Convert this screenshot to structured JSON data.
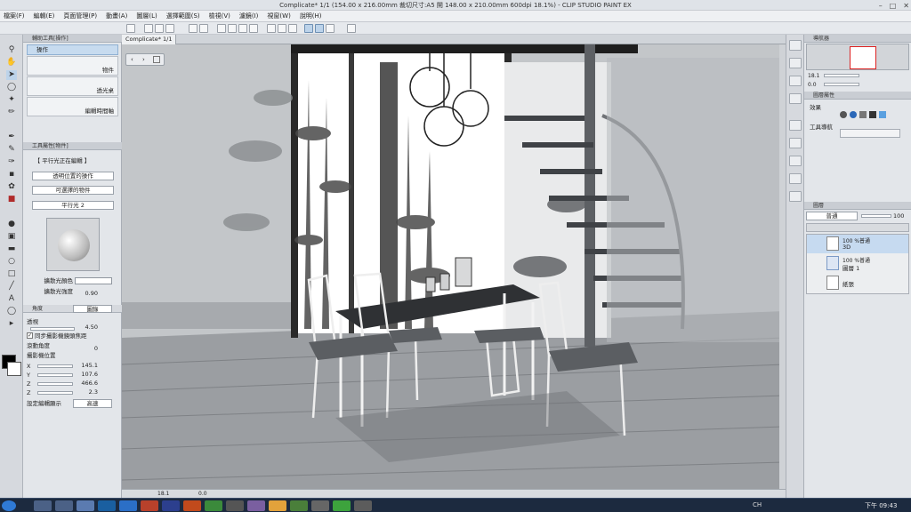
{
  "window": {
    "title": "Complicate* 1/1 (154.00 x 216.00mm 裁切尺寸:A5 開 148.00 x 210.00mm 600dpi 18.1%) - CLIP STUDIO PAINT EX"
  },
  "menu": [
    "檔案(F)",
    "編輯(E)",
    "頁面管理(P)",
    "動畫(A)",
    "圖層(L)",
    "選擇範圍(S)",
    "檢視(V)",
    "濾鏡(I)",
    "視窗(W)",
    "說明(H)"
  ],
  "document": {
    "tab_label": "Complicate* 1/1"
  },
  "subtool_panel": {
    "header": "輔助工具[操作]",
    "items": [
      {
        "label": "操作"
      },
      {
        "label": "物件"
      },
      {
        "label": "透光桌"
      },
      {
        "label": "編輯時間軸"
      }
    ]
  },
  "tool_property": {
    "header": "工具屬性[物件]",
    "editing_label": "【 平行光正在編輯 】",
    "transparent_label": "透明位置的操作",
    "selectable_label": "可選擇的物件",
    "light_name": "平行光 2",
    "ambient_color_label": "擴散光顏色",
    "ambient_strength_label": "擴散光強度",
    "ambient_strength_value": "0.90",
    "angle_label": "角度",
    "angle_mode": "圖錄",
    "perspective_label": "透視",
    "perspective_value": "4.50",
    "sync_label": "同步攝影機鏡頭焦距",
    "roll_label": "滾動角度",
    "roll_value": "0",
    "camera_pos_label": "攝影機位置",
    "camera": [
      {
        "axis": "X",
        "value": "145.1"
      },
      {
        "axis": "Y",
        "value": "107.6"
      },
      {
        "axis": "Z",
        "value": "466.6"
      },
      {
        "axis": "Z",
        "value": "2.3"
      }
    ],
    "display_label": "設定編輯顯示",
    "display_value": "高速"
  },
  "status": {
    "zoom": "18.1",
    "angle": "0.0"
  },
  "navigator": {
    "header": "導航器",
    "zoom": "18.1",
    "rotation": "0.0"
  },
  "layer_property": {
    "header": "圖層屬性",
    "effect_label": "效果",
    "tool_nav_label": "工具導航"
  },
  "layers": {
    "header": "圖層",
    "blend_mode": "普通",
    "opacity": "100",
    "items": [
      {
        "pct": "100 %普通",
        "name": "3D",
        "selected": true
      },
      {
        "pct": "100 %普通",
        "name": "圖層 1",
        "selected": false
      },
      {
        "pct": "",
        "name": "紙張",
        "selected": false
      }
    ]
  },
  "taskbar": {
    "lang": "CH",
    "clock": "下午 09:43"
  },
  "colors": {
    "accent": "#bcd3ea",
    "selected_layer": "#c6daf0"
  }
}
